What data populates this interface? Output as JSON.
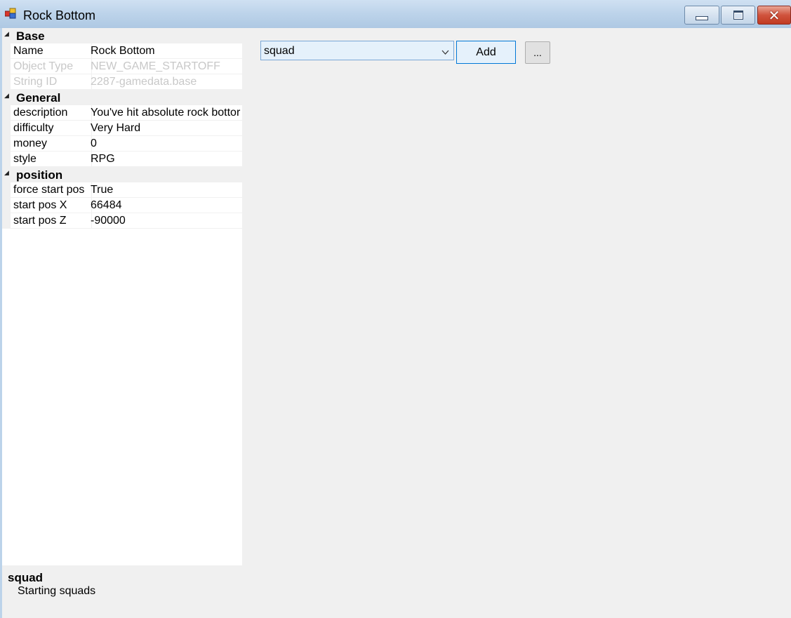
{
  "window": {
    "title": "Rock Bottom",
    "icon": "app-window-icon",
    "controls": {
      "minimize": "minimize-icon",
      "maximize": "maximize-icon",
      "close": "close-icon"
    }
  },
  "propgrid": {
    "categories": [
      {
        "label": "Base",
        "rows": [
          {
            "name": "Name",
            "value": "Rock Bottom",
            "disabled": false
          },
          {
            "name": "Object Type",
            "value": "NEW_GAME_STARTOFF",
            "disabled": true
          },
          {
            "name": "String ID",
            "value": "2287-gamedata.base",
            "disabled": true
          }
        ]
      },
      {
        "label": "General",
        "rows": [
          {
            "name": "description",
            "value": "You've hit absolute rock bottor",
            "disabled": false
          },
          {
            "name": "difficulty",
            "value": "Very Hard",
            "disabled": false
          },
          {
            "name": "money",
            "value": "0",
            "disabled": false
          },
          {
            "name": "style",
            "value": "RPG",
            "disabled": false
          }
        ]
      },
      {
        "label": "position",
        "rows": [
          {
            "name": "force start pos",
            "value": "True",
            "disabled": false
          },
          {
            "name": "start pos X",
            "value": "66484",
            "disabled": false
          },
          {
            "name": "start pos Z",
            "value": "-90000",
            "disabled": false
          }
        ]
      }
    ],
    "collapse_glyph": "◢"
  },
  "description": {
    "title": "squad",
    "text": "Starting squads"
  },
  "toolbar": {
    "combo_value": "squad",
    "add_label": "Add",
    "more_label": "..."
  },
  "colors": {
    "title_bar": "#bcd3ea",
    "close_button": "#c13b22",
    "accent": "#0078d7"
  }
}
